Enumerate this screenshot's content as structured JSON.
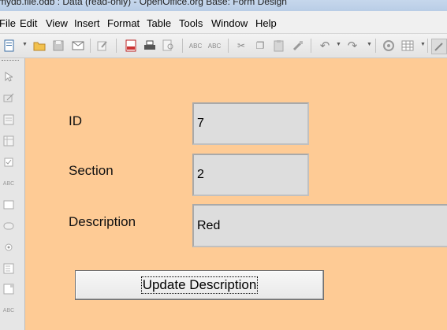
{
  "window": {
    "title": "mydb.file.odb : Data (read-only) - OpenOffice.org Base: Form Design"
  },
  "menu": {
    "file": "File",
    "edit": "Edit",
    "view": "View",
    "insert": "Insert",
    "format": "Format",
    "table": "Table",
    "tools": "Tools",
    "window": "Window",
    "help": "Help"
  },
  "toolbar_icons": [
    "new-icon",
    "open-folder-icon",
    "save-icon",
    "email-icon",
    "edit-file-icon",
    "pdf-export-icon",
    "print-icon",
    "page-preview-icon",
    "spellcheck-icon",
    "autospell-icon",
    "cut-icon",
    "copy-icon",
    "paste-icon",
    "format-paintbrush-icon",
    "undo-icon",
    "redo-icon",
    "navigator-icon",
    "table-icon",
    "draw-functions-icon"
  ],
  "form": {
    "id_label": "ID",
    "id_value": "7",
    "section_label": "Section",
    "section_value": "2",
    "description_label": "Description",
    "description_value": "Red",
    "update_button": "Update Description"
  },
  "colors": {
    "form_background": "#fecb95",
    "field_background": "#dddddd"
  }
}
